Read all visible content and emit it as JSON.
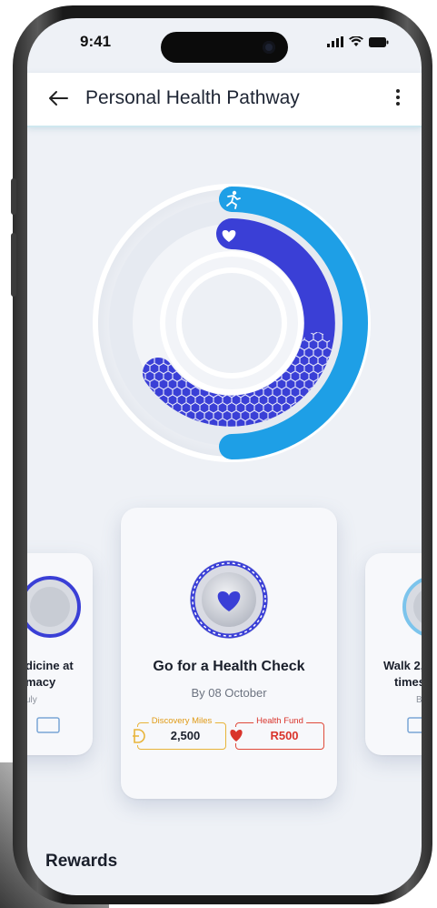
{
  "status_bar": {
    "time": "9:41"
  },
  "app_bar": {
    "title": "Personal Health Pathway"
  },
  "icons": {
    "back": "arrow-left-icon",
    "menu": "more-vertical-icon",
    "ring_outer": "running-figure-icon",
    "ring_inner": "heart-icon"
  },
  "ring": {
    "outer_color": "#1e9fe6",
    "inner_color": "#3a3fd6"
  },
  "cards": {
    "left": {
      "title_line1": "dicine at",
      "title_line2": "macy",
      "subtitle": "uly"
    },
    "main": {
      "title": "Go for a Health Check",
      "subtitle": "By 08 October",
      "reward1": {
        "label": "Discovery Miles",
        "value": "2,500"
      },
      "reward2": {
        "label": "Health Fund",
        "value": "R500"
      }
    },
    "right": {
      "title_line1": "Walk 2,",
      "title_line2": "times",
      "subtitle": "By"
    }
  },
  "section": {
    "rewards_title": "Rewards"
  },
  "colors": {
    "miles": "#e8b43a",
    "fund": "#e04a3a",
    "accent": "#3a3fd6"
  }
}
